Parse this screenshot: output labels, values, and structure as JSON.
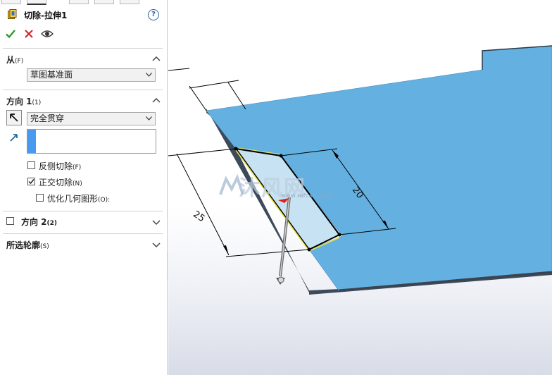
{
  "feature": {
    "title": "切除-拉伸1",
    "help_label": "?"
  },
  "actions": {
    "ok_icon": "checkmark-icon",
    "cancel_icon": "close-icon",
    "preview_icon": "eye-icon"
  },
  "from": {
    "title": "从",
    "shortcut": "(F)",
    "value": "草图基准面"
  },
  "direction1": {
    "title": "方向 1",
    "shortcut": "(1)",
    "end_condition": "完全贯穿",
    "options": [
      {
        "label": "反侧切除",
        "shortcut": "(F)",
        "checked": false
      },
      {
        "label": "正交切除",
        "shortcut": "(N)",
        "checked": true
      },
      {
        "label": "优化几何图形",
        "shortcut": "(O):",
        "checked": false
      }
    ]
  },
  "direction2": {
    "title": "方向 2",
    "shortcut": "(2)",
    "checked": false
  },
  "contours": {
    "title": "所选轮廓",
    "shortcut": "(S)"
  },
  "dimensions": {
    "d1": "20",
    "d2": "25"
  },
  "watermark": {
    "cn": "沐风网",
    "url": "www.mfcad.com"
  },
  "colors": {
    "accent": "#4a99f0",
    "part": "#64b1e1",
    "cut": "#c7e2f3",
    "ok": "#2e9a2e",
    "cancel": "#cc2222"
  }
}
